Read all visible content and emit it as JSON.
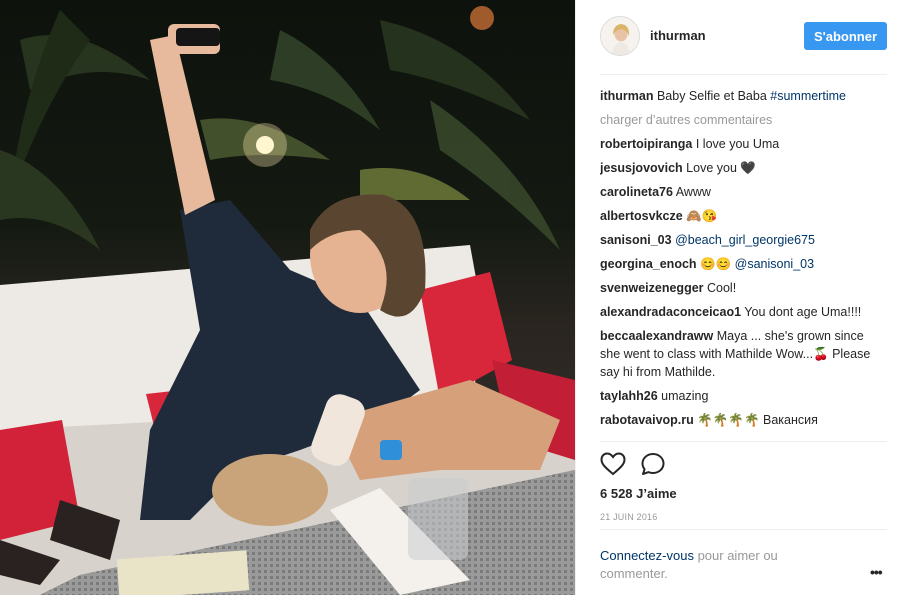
{
  "photo": {
    "alt_hint": "Night selfie photo of a woman on a sofa with a child drinking from a bottle"
  },
  "header": {
    "username": "ithurman",
    "follow_label": "S'abonner",
    "follow_color": "#3897f0"
  },
  "caption": {
    "user": "ithurman",
    "text": "Baby Selfie et Baba ",
    "hashtag": "#summertime"
  },
  "load_more": "charger d’autres commentaires",
  "comments": [
    {
      "user": "robertoipiranga",
      "text": "I love you Uma"
    },
    {
      "user": "jesusjovovich",
      "text": "Love you 🖤"
    },
    {
      "user": "carolineta76",
      "text": "Awww"
    },
    {
      "user": "albertosvkcze",
      "text": "🙈😘"
    },
    {
      "user": "sanisoni_03",
      "text": "",
      "mention": "@beach_girl_georgie675"
    },
    {
      "user": "georgina_enoch",
      "text": "😊😊 ",
      "mention": "@sanisoni_03"
    },
    {
      "user": "svenweizenegger",
      "text": "Cool!"
    },
    {
      "user": "alexandradaconceicao1",
      "text": "You dont age Uma!!!!"
    },
    {
      "user": "beccaalexandraww",
      "text": "Maya ... she's grown since she went to class with Mathilde Wow...🍒 Please say hi from Mathilde."
    },
    {
      "user": "taylahh26",
      "text": "umazing"
    },
    {
      "user": "rabotavaivop.ru",
      "text": "🌴🌴🌴🌴 Вакансия"
    }
  ],
  "actions": {
    "like_icon": "heart-icon",
    "comment_icon": "comment-icon"
  },
  "likes": "6 528 J’aime",
  "date": "21 JUIN 2016",
  "login": {
    "link": "Connectez-vous",
    "rest": " pour aimer ou commenter."
  },
  "more_options": "•••"
}
